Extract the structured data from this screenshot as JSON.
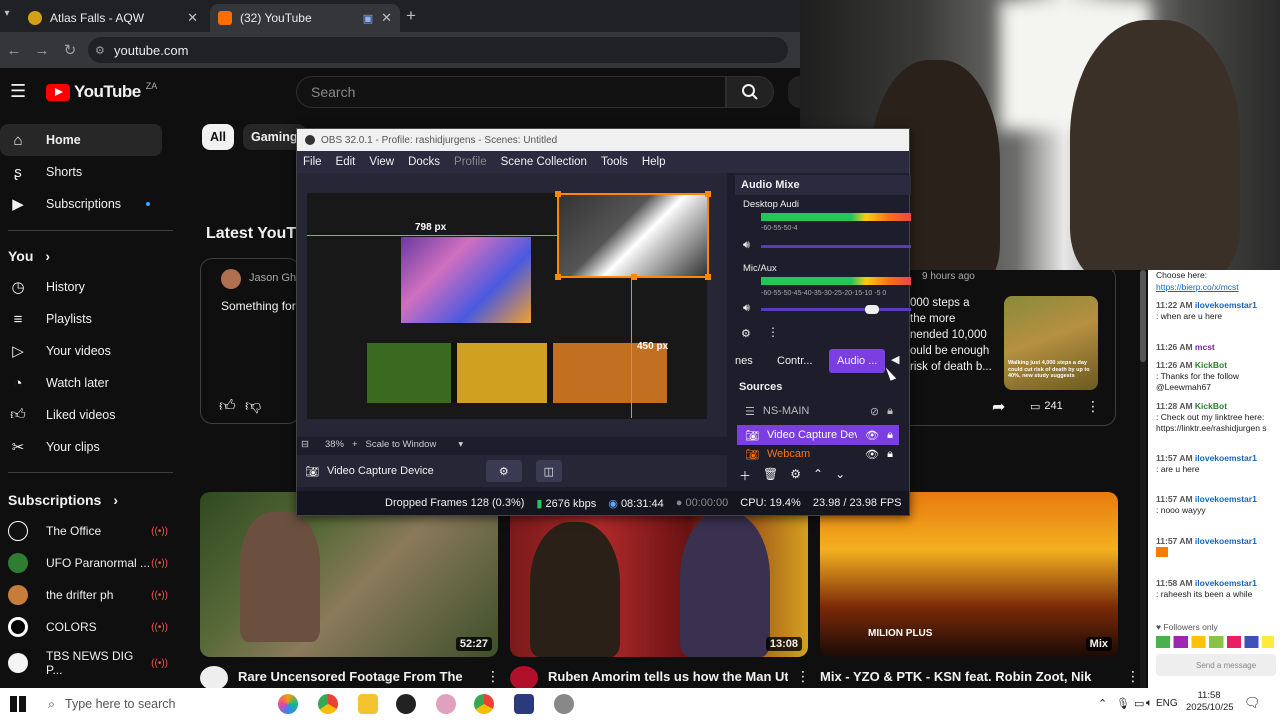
{
  "browser": {
    "tabs": [
      {
        "title": "Atlas Falls - AQW",
        "active": false
      },
      {
        "title": "(32) YouTube",
        "active": true
      }
    ],
    "new_tab": "+",
    "url": "youtube.com"
  },
  "youtube": {
    "logo_text": "YouTube",
    "region": "ZA",
    "search_placeholder": "Search",
    "chips": [
      "All",
      "Gaming"
    ],
    "section_title": "Latest YouT",
    "sidebar": {
      "main": [
        {
          "label": "Home",
          "icon": "home-icon"
        },
        {
          "label": "Shorts",
          "icon": "shorts-icon"
        },
        {
          "label": "Subscriptions",
          "icon": "subscriptions-icon"
        }
      ],
      "you_header": "You",
      "you_items": [
        {
          "label": "History",
          "icon": "history-icon"
        },
        {
          "label": "Playlists",
          "icon": "playlists-icon"
        },
        {
          "label": "Your videos",
          "icon": "your-videos-icon"
        },
        {
          "label": "Watch later",
          "icon": "watch-later-icon"
        },
        {
          "label": "Liked videos",
          "icon": "liked-videos-icon"
        },
        {
          "label": "Your clips",
          "icon": "clips-icon"
        }
      ],
      "subs_header": "Subscriptions",
      "channels": [
        {
          "name": "The Office",
          "color": "#ffffff"
        },
        {
          "name": "UFO Paranormal ...",
          "color": "#2e7d32"
        },
        {
          "name": "the drifter ph",
          "color": "#c77d3a"
        },
        {
          "name": "COLORS",
          "color": "#ffffff"
        },
        {
          "name": "TBS NEWS DIG P...",
          "color": "#ffffff"
        }
      ]
    },
    "post": {
      "author": "Jason Gho",
      "text": "Something for t",
      "time": "9 hours ago",
      "body_lines": [
        "000 steps a",
        "the more",
        "nended 10,000",
        "ould be enough",
        "risk of death b..."
      ],
      "image_caption": "Walking just 4,000 steps a day could cut risk of death by up to 40%, new study suggests",
      "comments": "241"
    },
    "videos": [
      {
        "title": "Rare Uncensored Footage From The",
        "duration": "52:27"
      },
      {
        "title": "Ruben Amorim tells us how the Man Utd",
        "duration": "13:08"
      },
      {
        "title": "Mix - YZO & PTK - KSN feat. Robin Zoot, Nik",
        "duration": "Mix",
        "overlay": "MILION PLUS"
      }
    ]
  },
  "obs": {
    "title": "OBS 32.0.1 - Profile: rashidjurgens - Scenes: Untitled",
    "menu": [
      "File",
      "Edit",
      "View",
      "Docks",
      "Profile",
      "Scene Collection",
      "Tools",
      "Help"
    ],
    "preview_labels": {
      "width": "798 px",
      "height": "450 px"
    },
    "zoom": "38%",
    "scale_mode": "Scale to Window",
    "selected_source": "Video Capture Device",
    "audio_mixer": {
      "title": "Audio Mixe",
      "channels": [
        {
          "name": "Desktop Audi",
          "scale": "-60-55-50-4"
        },
        {
          "name": "Mic/Aux",
          "scale": "-60-55-50-45-40-35-30-25-20-15-10 -5 0"
        }
      ]
    },
    "dock_tabs": [
      "nes",
      "Contr...",
      "Audio ..."
    ],
    "sources_title": "Sources",
    "sources": [
      "NS-MAIN",
      "Video Capture Devic",
      "Webcam"
    ],
    "status": {
      "dropped": "Dropped Frames 128 (0.3%)",
      "bitrate": "2676 kbps",
      "stream_time": "08:31:44",
      "rec_time": "00:00:00",
      "cpu": "CPU: 19.4%",
      "fps": "23.98 / 23.98 FPS"
    }
  },
  "chat": {
    "messages": [
      {
        "time": "",
        "name": "",
        "text": "Choose here:"
      },
      {
        "time": "",
        "name": "",
        "text": "https://bierp.co/x/mcst"
      },
      {
        "time": "11:22 AM",
        "name": "ilovekoemstar1",
        "text": ": when are u here"
      },
      {
        "time": "11:26 AM",
        "name": "mcst",
        "text": ""
      },
      {
        "time": "11:26 AM",
        "name": "KickBot",
        "text": ": Thanks for the follow @Leewmah67"
      },
      {
        "time": "11:28 AM",
        "name": "KickBot",
        "text": ": Check out my linktree here: https://linktr.ee/rashidjurgen s"
      },
      {
        "time": "11:57 AM",
        "name": "ilovekoemstar1",
        "text": ": are u here"
      },
      {
        "time": "11:57 AM",
        "name": "ilovekoemstar1",
        "text": ": nooo wayyy"
      },
      {
        "time": "11:57 AM",
        "name": "ilovekoemstar1",
        "text": ""
      },
      {
        "time": "11:58 AM",
        "name": "ilovekoemstar1",
        "text": ": raheesh its been a while"
      }
    ],
    "followers_only": "Followers only",
    "send_label": "Send a message"
  },
  "taskbar": {
    "search_placeholder": "Type here to search",
    "language": "ENG",
    "time": "11:58",
    "date": "2025/10/25"
  }
}
